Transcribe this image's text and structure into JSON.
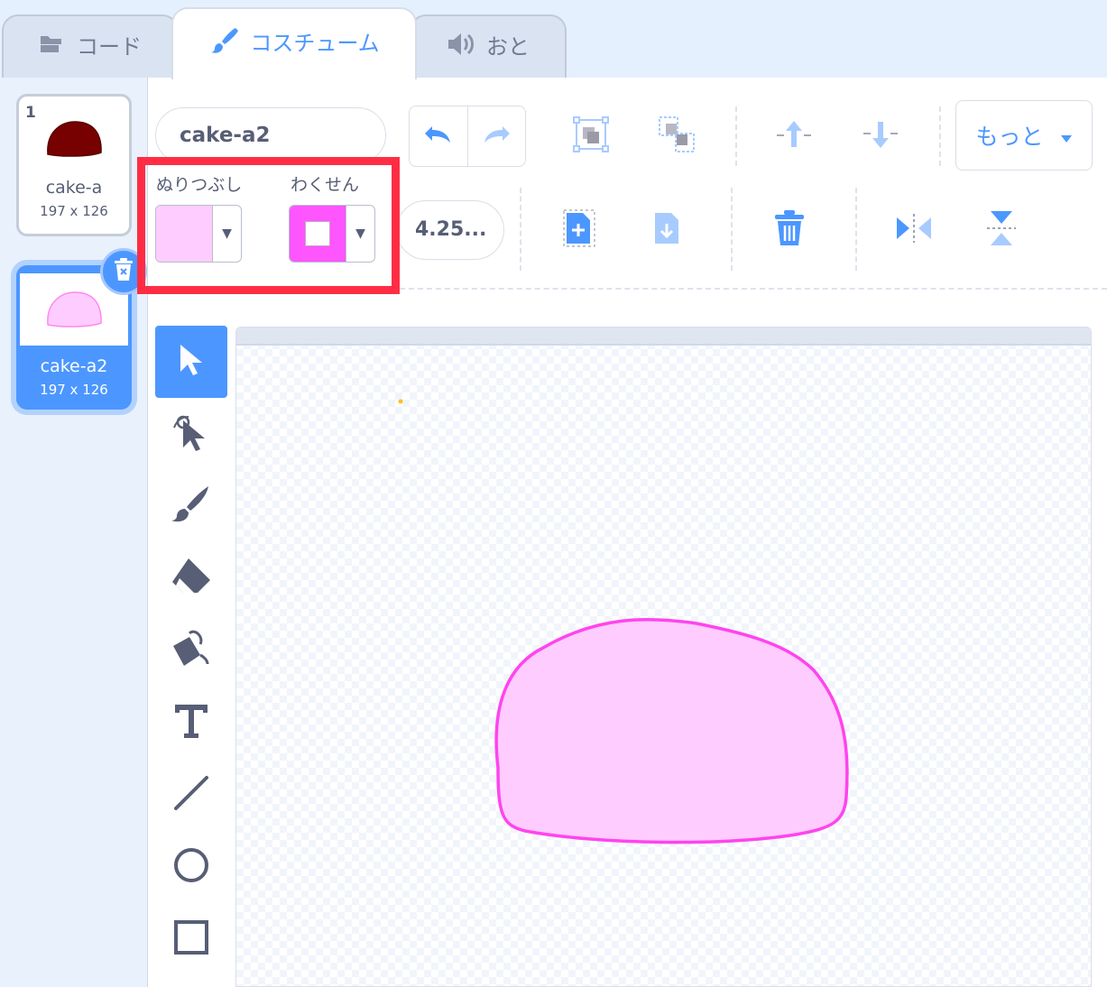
{
  "tabs": [
    {
      "label": "コード",
      "icon": "code-blocks-icon",
      "active": false
    },
    {
      "label": "コスチューム",
      "icon": "paintbrush-icon",
      "active": true
    },
    {
      "label": "おと",
      "icon": "speaker-icon",
      "active": false
    }
  ],
  "costumes": [
    {
      "index": "1",
      "name": "cake-a",
      "size": "197 x 126",
      "fill": "#7a0000",
      "selected": false
    },
    {
      "index": "2",
      "name": "cake-a2",
      "size": "197 x 126",
      "fill": "#ffccff",
      "selected": true
    }
  ],
  "editor": {
    "costume_name": "cake-a2",
    "more_label": "もっと",
    "fill_label": "ぬりつぶし",
    "outline_label": "わくせん",
    "fill_color": "#ffccff",
    "outline_color": "#ff55ff",
    "stroke_width": "4.25..."
  },
  "toolbar_icons": [
    "undo-icon",
    "redo-icon",
    "group-icon",
    "ungroup-icon",
    "forward-icon",
    "backward-icon",
    "new-costume-icon",
    "export-icon",
    "delete-icon",
    "flip-horizontal-icon",
    "flip-vertical-icon"
  ],
  "tools": [
    "select-tool",
    "reshape-tool",
    "brush-tool",
    "eraser-tool",
    "fill-tool",
    "text-tool",
    "line-tool",
    "circle-tool",
    "rectangle-tool"
  ],
  "colors": {
    "accent": "#4c97ff",
    "highlight": "#ff2d44",
    "shape_fill": "#ffccff",
    "shape_stroke": "#ff44ee"
  }
}
